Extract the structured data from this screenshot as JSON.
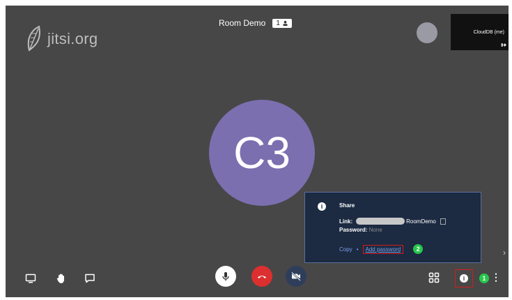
{
  "logo": {
    "text": "jitsi.org",
    "icon": "jitsi-leaf-icon"
  },
  "header": {
    "room_name": "Room Demo",
    "participant_count": "1",
    "count_icon": "participants-icon"
  },
  "self_view": {
    "name": "CloudDB (me)",
    "icon": "mic-muted-icon"
  },
  "main": {
    "avatar_initials": "C3",
    "avatar_color": "#7b6fb0"
  },
  "share_popup": {
    "title": "Share",
    "link_label": "Link:",
    "link_value": "RoomDemo",
    "password_label": "Password:",
    "password_value": "None",
    "copy_label": "Copy",
    "separator": "•",
    "add_password_label": "Add password",
    "step_badge": "2"
  },
  "toolbar": {
    "left": [
      "screen-share-icon",
      "raise-hand-icon",
      "chat-icon"
    ],
    "center": [
      "microphone-icon",
      "hangup-icon",
      "video-off-icon"
    ],
    "right": [
      "tile-view-icon",
      "info-icon",
      "more-icon"
    ],
    "step_badge": "1",
    "more_glyph": "⋮"
  },
  "colors": {
    "background": "#474747",
    "hangup": "#dc2f2f",
    "highlight": "#d41c1c",
    "badge": "#27c64a",
    "popup_bg": "#1c2a42"
  }
}
